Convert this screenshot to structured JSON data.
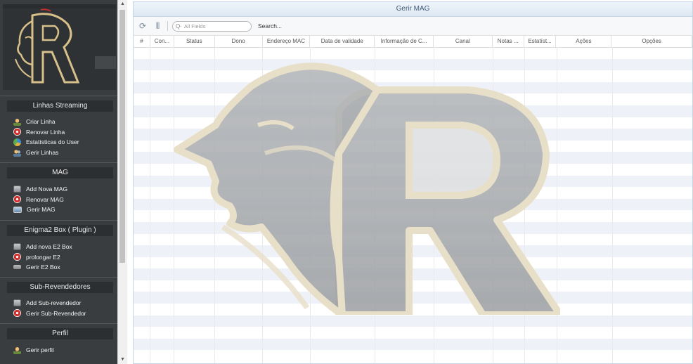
{
  "sidebar": {
    "sections": [
      {
        "title": "Linhas Streaming",
        "items": [
          {
            "label": "Criar Linha",
            "icon": "user-add-icon"
          },
          {
            "label": "Renovar Linha",
            "icon": "renew-icon"
          },
          {
            "label": "Estatísticas do User",
            "icon": "stats-icon"
          },
          {
            "label": "Gerir Linhas",
            "icon": "users-icon"
          }
        ]
      },
      {
        "title": "MAG",
        "items": [
          {
            "label": "Add Nova MAG",
            "icon": "device-add-icon"
          },
          {
            "label": "Renovar MAG",
            "icon": "renew-icon"
          },
          {
            "label": "Gerir MAG",
            "icon": "monitor-icon"
          }
        ]
      },
      {
        "title": "Enigma2 Box ( Plugin )",
        "items": [
          {
            "label": "Add nova E2 Box",
            "icon": "device-add-icon"
          },
          {
            "label": "prolongar E2",
            "icon": "renew-icon"
          },
          {
            "label": "Gerir E2 Box",
            "icon": "box-icon"
          }
        ]
      },
      {
        "title": "Sub-Revendedores",
        "items": [
          {
            "label": "Add Sub-revendedor",
            "icon": "device-add-icon"
          },
          {
            "label": "Gerir Sub-Revendedor",
            "icon": "renew-icon"
          }
        ]
      },
      {
        "title": "Perfil",
        "items": [
          {
            "label": "Gerir perfil",
            "icon": "user-icon"
          }
        ]
      }
    ]
  },
  "panel": {
    "title": "Gerir MAG",
    "search_placeholder": "All Fields",
    "search_label": "Search...",
    "columns": [
      "#",
      "Con...",
      "Status",
      "Dono",
      "Endereço MAC",
      "Data de validade",
      "Informação de C...",
      "Canal",
      "Notas ...",
      "Estatíst...",
      "Ações",
      "Opções"
    ]
  },
  "colors": {
    "sidebar_bg": "#3a3d3f",
    "header_bg": "#dde8f3",
    "row_alt": "#eef2f8",
    "logo_gold": "#d8c08a"
  }
}
